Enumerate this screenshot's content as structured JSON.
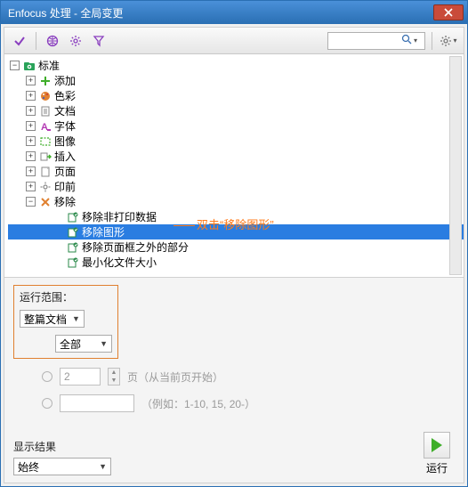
{
  "window": {
    "title": "Enfocus 处理 - 全局变更"
  },
  "toolbar": {
    "search_placeholder": ""
  },
  "tree": {
    "root_label": "标准",
    "nodes": [
      {
        "key": "add",
        "label": "添加",
        "expander": "+",
        "icon": "plus"
      },
      {
        "key": "color",
        "label": "色彩",
        "expander": "+",
        "icon": "palette"
      },
      {
        "key": "doc",
        "label": "文档",
        "expander": "+",
        "icon": "doc"
      },
      {
        "key": "font",
        "label": "字体",
        "expander": "+",
        "icon": "font"
      },
      {
        "key": "image",
        "label": "图像",
        "expander": "+",
        "icon": "dashed"
      },
      {
        "key": "insert",
        "label": "插入",
        "expander": "+",
        "icon": "insert"
      },
      {
        "key": "page",
        "label": "页面",
        "expander": "+",
        "icon": "page"
      },
      {
        "key": "preprint",
        "label": "印前",
        "expander": "+",
        "icon": "gear"
      },
      {
        "key": "remove",
        "label": "移除",
        "expander": "−",
        "icon": "xmark"
      }
    ],
    "remove_children": [
      {
        "label": "移除非打印数据"
      },
      {
        "label": "移除图形",
        "selected": true
      },
      {
        "label": "移除页面框之外的部分"
      },
      {
        "label": "最小化文件大小"
      }
    ]
  },
  "annotation": {
    "text": "双击“移除图形”"
  },
  "scope": {
    "title": "运行范围：",
    "doc_combo": "整篇文档",
    "all_combo": "全部",
    "pages_value": "2",
    "pages_suffix": "页（从当前页开始）",
    "range_hint": "（例如：1-10, 15, 20-）"
  },
  "footer": {
    "result_label": "显示结果",
    "result_combo": "始终",
    "run_label": "运行"
  },
  "colors": {
    "select_bg": "#2a7de1",
    "orange": "#ff7a1a",
    "scope_border": "#e08030"
  }
}
